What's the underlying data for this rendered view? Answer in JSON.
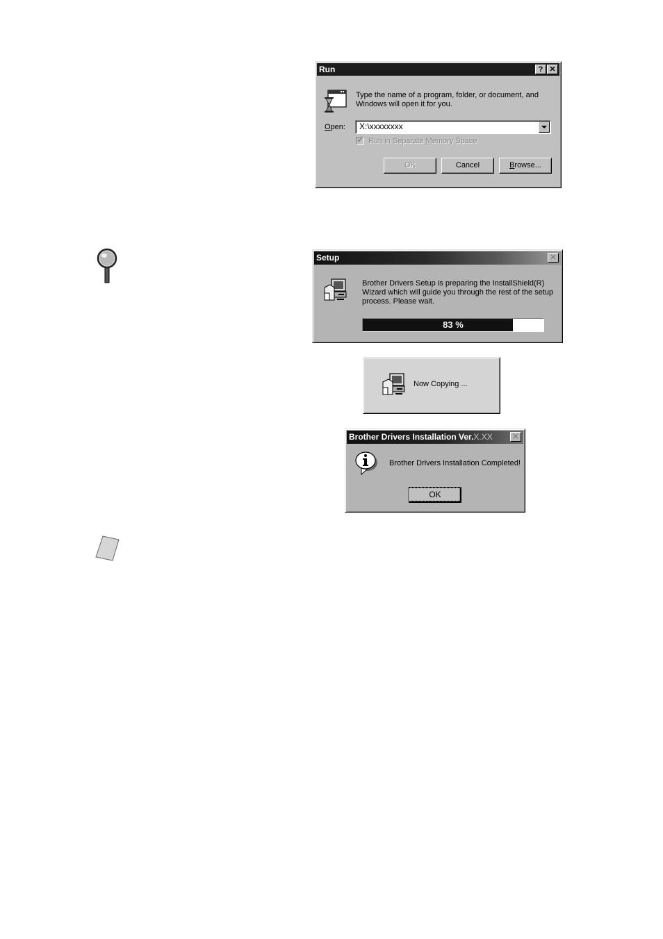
{
  "run_dialog": {
    "title": "Run",
    "help_button": "?",
    "close_button": "✕",
    "icon": "run-program-hourglass-icon",
    "description_line1": "Type the name of a program, folder, or document, and",
    "description_line2": "Windows will open it for you.",
    "open_label_accel": "O",
    "open_label_rest": "pen:",
    "open_value": "X:\\xxxxxxxx",
    "checkbox_label_pre": "Run in Separate ",
    "checkbox_label_accel": "M",
    "checkbox_label_post": "emory Space",
    "checkbox_checked": true,
    "checkbox_disabled": true,
    "ok_label": "OK",
    "cancel_label": "Cancel",
    "browse_accel": "B",
    "browse_rest": "rowse..."
  },
  "setup_dialog": {
    "title": "Setup",
    "close_button": "✕",
    "icon": "setup-computer-icon",
    "message_line1": "Brother Drivers Setup is preparing the InstallShield(R)",
    "message_line2": "Wizard which will guide you through the rest of the setup",
    "message_line3": "process.  Please wait.",
    "progress_percent": 83,
    "progress_label": "83 %"
  },
  "copying_dialog": {
    "icon": "setup-computer-icon",
    "message": "Now Copying ..."
  },
  "completed_dialog": {
    "title_main": "Brother Drivers Installation Ver.",
    "title_version": "X.XX",
    "close_button": "✕",
    "icon": "information-icon",
    "message": "Brother Drivers Installation Completed!",
    "ok_label": "OK"
  },
  "margin_icons": {
    "tip_icon": "magnifier-icon",
    "note_icon": "note-paper-icon"
  }
}
